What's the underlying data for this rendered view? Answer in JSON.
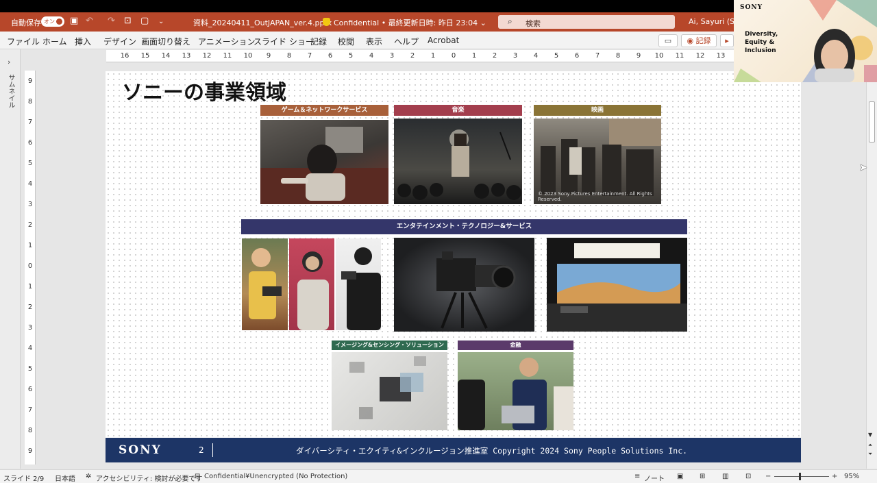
{
  "app": {
    "autosave_label": "自動保存",
    "autosave_state": "オン",
    "filename": "資料_20240411_OutJAPAN_ver.4.pptx",
    "confidential": "Confidential • 最終更新日時: 昨日 23:04 ⌄",
    "search_placeholder": "検索",
    "user": "Ai, Sayuri (SP"
  },
  "ribbon": {
    "tabs": [
      "ファイル",
      "ホーム",
      "挿入",
      "デザイン",
      "画面切り替え",
      "アニメーション",
      "スライド ショー",
      "記録",
      "校閲",
      "表示",
      "ヘルプ",
      "Acrobat"
    ],
    "record_button": "◉ 記録"
  },
  "rail": {
    "thumbnail_label": "サムネイル"
  },
  "ruler": {
    "horizontal": [
      "16",
      "15",
      "14",
      "13",
      "12",
      "11",
      "10",
      "9",
      "8",
      "7",
      "6",
      "5",
      "4",
      "3",
      "2",
      "1",
      "0",
      "1",
      "2",
      "3",
      "4",
      "5",
      "6",
      "7",
      "8",
      "9",
      "10",
      "11",
      "12",
      "13"
    ],
    "vertical": [
      "9",
      "8",
      "7",
      "6",
      "5",
      "4",
      "3",
      "2",
      "1",
      "0",
      "1",
      "2",
      "3",
      "4",
      "5",
      "6",
      "7",
      "8",
      "9"
    ]
  },
  "slide": {
    "title": "ソニーの事業領域",
    "categories": {
      "game": "ゲーム＆ネットワークサービス",
      "music": "音楽",
      "movie": "映画",
      "ets": "エンタテインメント・テクノロジー&サービス",
      "imaging": "イメージング&センシング・ソリューション",
      "finance": "金融"
    },
    "photo_caption": "© 2023 Sony Pictures Entertainment. All Rights Reserved.",
    "footer": {
      "logo": "SONY",
      "page": "2",
      "copyright": "ダイバーシティ・エクイティ&インクルージョン推進室  Copyright 2024 Sony People Solutions Inc."
    }
  },
  "status": {
    "slide": "スライド 2/9",
    "language": "日本語",
    "accessibility": "アクセシビリティ: 検討が必要です",
    "sensitivity": "Confidential¥Unencrypted (No Protection)",
    "notes": "ノート",
    "zoom": "95%"
  },
  "webcam": {
    "brand": "SONY",
    "banner": "Diversity, Equity & Inclusion"
  },
  "colors": {
    "titlebar": "#b7472a",
    "game": "#a8603a",
    "music": "#a33e4d",
    "movie": "#8a7436",
    "ets": "#34366a",
    "imaging": "#2f6a50",
    "finance": "#5b3a6a",
    "footer": "#1d3566"
  }
}
